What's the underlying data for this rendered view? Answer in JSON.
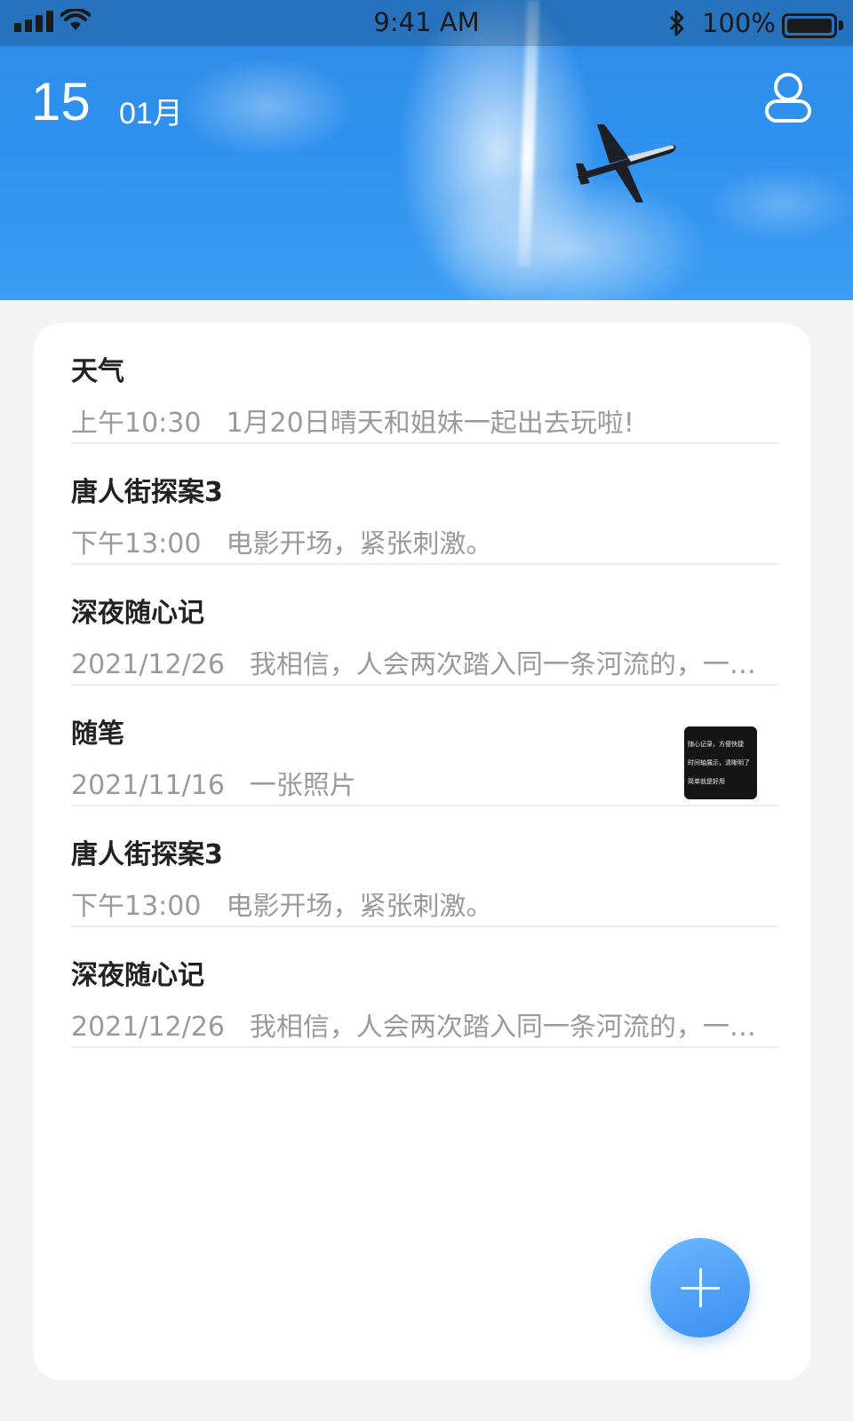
{
  "status_bar": {
    "time": "9:41 AM",
    "battery": "100%"
  },
  "header": {
    "day": "15",
    "month": "01月"
  },
  "notes": [
    {
      "title": "天气",
      "time": "上午10:30",
      "preview": "1月20日晴天和姐妹一起出去玩啦!"
    },
    {
      "title": "唐人街探案3",
      "time": "下午13:00",
      "preview": "电影开场，紧张刺激。"
    },
    {
      "title": "深夜随心记",
      "time": "2021/12/26",
      "preview": "我相信，人会两次踏入同一条河流的，一个心里有大海的人"
    },
    {
      "title": "随笔",
      "time": "2021/11/16",
      "preview": "一张照片",
      "thumbnail_lines": [
        "随心记录，方便快捷",
        "时间轴展示，清晰明了",
        "简单就是好用"
      ]
    },
    {
      "title": "唐人街探案3",
      "time": "下午13:00",
      "preview": "电影开场，紧张刺激。"
    },
    {
      "title": "深夜随心记",
      "time": "2021/12/26",
      "preview": "我相信，人会两次踏入同一条河流的，一个心里有大海的人"
    }
  ],
  "icons": {
    "user": "user-icon",
    "add": "plus-icon",
    "signal": "signal-icon",
    "wifi": "wifi-icon",
    "bluetooth": "bluetooth-icon",
    "battery": "battery-icon"
  },
  "colors": {
    "accent": "#3a8ff2",
    "sky": "#2f8be6"
  }
}
